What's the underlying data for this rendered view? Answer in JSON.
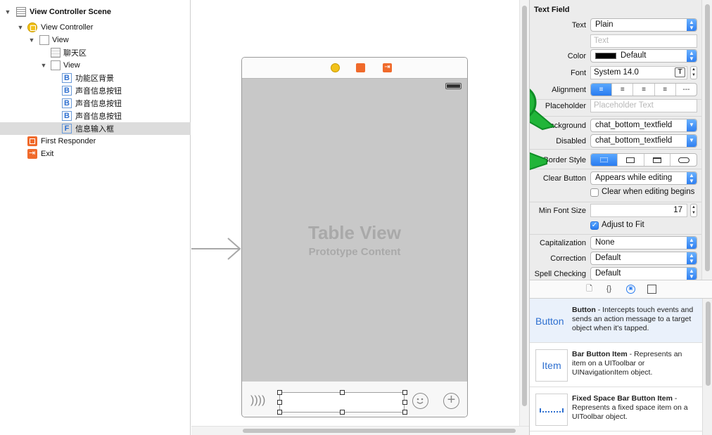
{
  "outline": {
    "rows": [
      {
        "label": "View Controller Scene",
        "bold": true
      },
      {
        "label": "View Controller"
      },
      {
        "label": "View"
      },
      {
        "label": "聊天区"
      },
      {
        "label": "View"
      },
      {
        "label": "功能区背景"
      },
      {
        "label": "声音信息按钮"
      },
      {
        "label": "声音信息按钮"
      },
      {
        "label": "声音信息按钮"
      },
      {
        "label": "信息输入框",
        "selected": true
      },
      {
        "label": "First Responder"
      },
      {
        "label": "Exit"
      }
    ]
  },
  "canvas": {
    "table_view_title": "Table View",
    "table_view_subtitle": "Prototype Content"
  },
  "inspector": {
    "section_title": "Text Field",
    "text_label": "Text",
    "text_value": "Plain",
    "text_placeholder": "Text",
    "color_label": "Color",
    "color_value": "Default",
    "color_swatch": "#000000",
    "font_label": "Font",
    "font_value": "System 14.0",
    "font_icon": "T",
    "alignment_label": "Alignment",
    "alignment_options": [
      "left",
      "center",
      "right",
      "justified",
      "natural"
    ],
    "alignment_selected": "left",
    "alignment_natural_glyph": "---",
    "placeholder_label": "Placeholder",
    "placeholder_hint": "Placeholder Text",
    "background_label": "Background",
    "background_value": "chat_bottom_textfield",
    "disabled_label": "Disabled",
    "disabled_value": "chat_bottom_textfield",
    "border_label": "Border Style",
    "border_options": [
      "none",
      "line",
      "bezel",
      "rounded"
    ],
    "border_selected": "none",
    "clear_button_label": "Clear Button",
    "clear_button_value": "Appears while editing",
    "clear_editing_label": "Clear when editing begins",
    "clear_editing_checked": false,
    "min_font_label": "Min Font Size",
    "min_font_value": "17",
    "adjust_label": "Adjust to Fit",
    "adjust_checked": true,
    "capitalization_label": "Capitalization",
    "capitalization_value": "None",
    "correction_label": "Correction",
    "correction_value": "Default",
    "spell_label": "Spell Checking",
    "spell_value": "Default"
  },
  "library": {
    "tabs": [
      "file-template-icon",
      "code-snippet-icon",
      "object-library-icon",
      "media-library-icon"
    ],
    "active_tab": "object-library-icon",
    "items": [
      {
        "icon_text": "Button",
        "name": "Button",
        "desc": " - Intercepts touch events and sends an action message to a target object when it's tapped."
      },
      {
        "icon_text": "Item",
        "name": "Bar Button Item",
        "desc": " - Represents an item on a UIToolbar or UINavigationItem object."
      },
      {
        "icon_text": "",
        "name": "Fixed Space Bar Button Item",
        "desc": " - Represents a fixed space item on a UIToolbar object."
      }
    ]
  },
  "colors": {
    "accent": "#2a7cf0",
    "selection": "#dcdcdc",
    "check_badge": "#21b539",
    "canvas_table": "#c8c8c8",
    "exit_orange": "#f06a2b"
  }
}
